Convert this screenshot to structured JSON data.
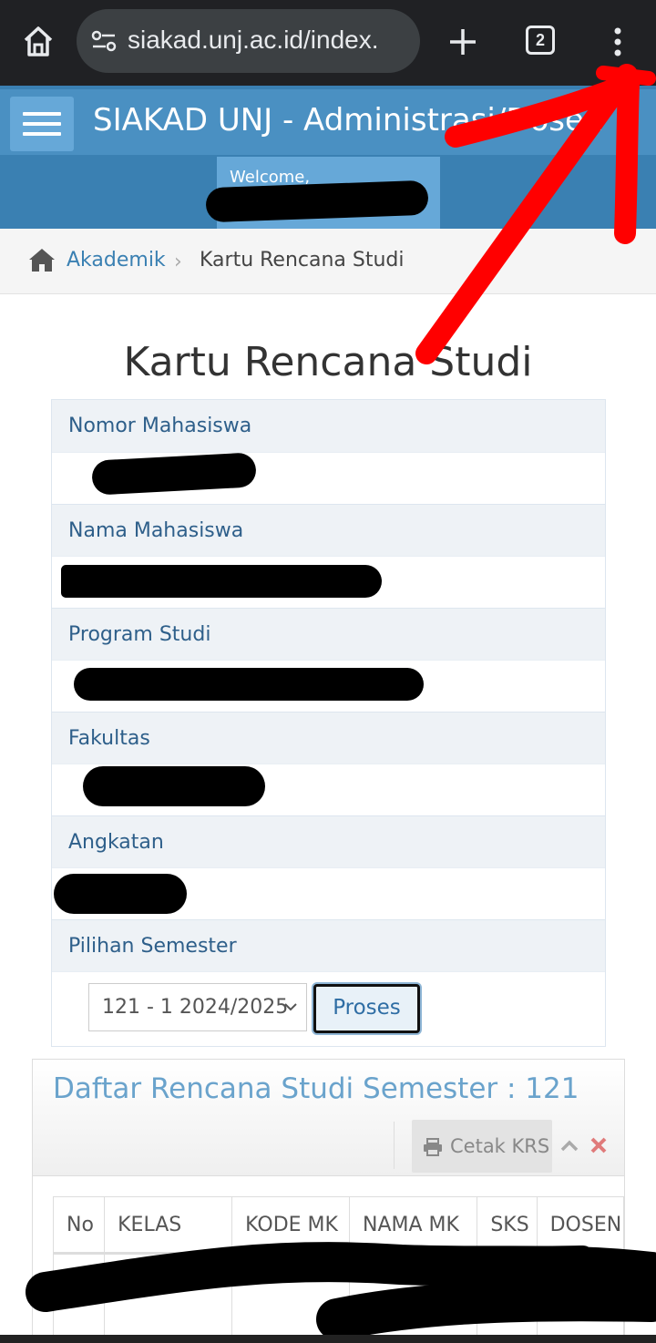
{
  "browser": {
    "url": "siakad.unj.ac.id/index.",
    "tab_count": "2"
  },
  "header": {
    "title": "SIAKAD UNJ - Administrasi/Dosen",
    "welcome": "Welcome,"
  },
  "breadcrumb": {
    "parent": "Akademik",
    "separator": "›",
    "current": "Kartu Rencana Studi"
  },
  "page_title": "Kartu Rencana Studi",
  "form": {
    "fields": [
      {
        "label": "Nomor Mahasiswa"
      },
      {
        "label": "Nama Mahasiswa"
      },
      {
        "label": "Program Studi"
      },
      {
        "label": "Fakultas"
      },
      {
        "label": "Angkatan"
      }
    ],
    "semester_label": "Pilihan Semester",
    "semester_selected": "121 - 1 2024/2025",
    "proses_label": "Proses"
  },
  "widget": {
    "title": "Daftar Rencana Studi Semester : 121",
    "cetak_label": "Cetak KRS",
    "columns": [
      "No",
      "KELAS",
      "KODE MK",
      "NAMA MK",
      "SKS",
      "DOSEN"
    ]
  },
  "colors": {
    "header_blue": "#4a90c2",
    "link_blue": "#3a80b2",
    "annotation_red": "#ff0000"
  }
}
